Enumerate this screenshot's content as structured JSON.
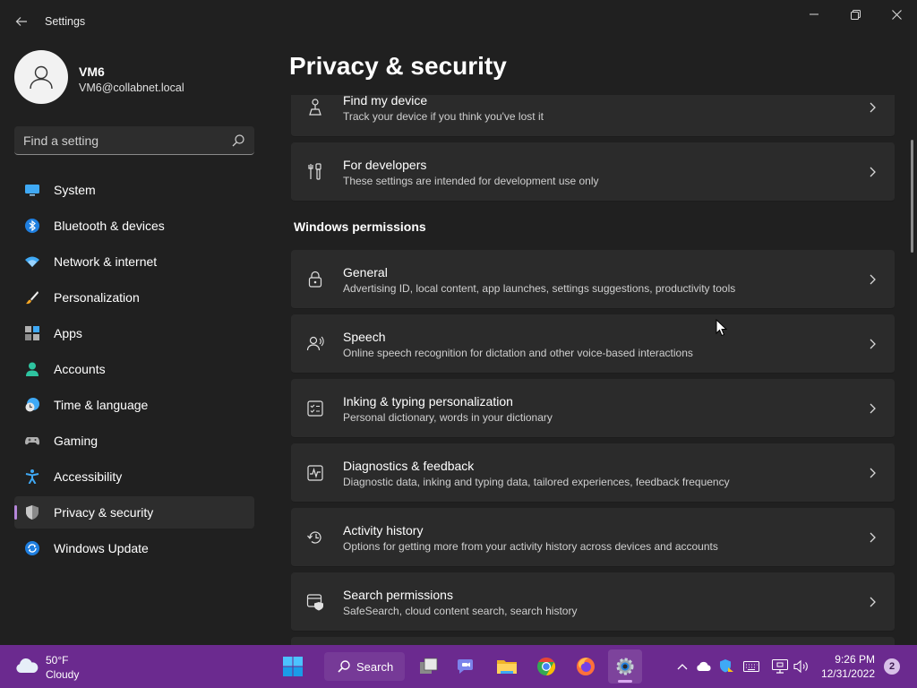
{
  "app": {
    "title": "Settings"
  },
  "profile": {
    "name": "VM6",
    "email": "VM6@collabnet.local"
  },
  "search": {
    "placeholder": "Find a setting"
  },
  "sidebar": {
    "items": [
      {
        "label": "System",
        "icon": "monitor-icon"
      },
      {
        "label": "Bluetooth & devices",
        "icon": "bluetooth-icon"
      },
      {
        "label": "Network & internet",
        "icon": "wifi-icon"
      },
      {
        "label": "Personalization",
        "icon": "brush-icon"
      },
      {
        "label": "Apps",
        "icon": "apps-icon"
      },
      {
        "label": "Accounts",
        "icon": "person-icon"
      },
      {
        "label": "Time & language",
        "icon": "clock-globe-icon"
      },
      {
        "label": "Gaming",
        "icon": "gamepad-icon"
      },
      {
        "label": "Accessibility",
        "icon": "accessibility-icon"
      },
      {
        "label": "Privacy & security",
        "icon": "shield-icon",
        "active": true
      },
      {
        "label": "Windows Update",
        "icon": "update-icon"
      }
    ]
  },
  "page": {
    "title": "Privacy & security",
    "section_windows_permissions": "Windows permissions",
    "cards": [
      {
        "title": "Find my device",
        "desc": "Track your device if you think you've lost it",
        "icon": "person-location-icon"
      },
      {
        "title": "For developers",
        "desc": "These settings are intended for development use only",
        "icon": "developer-tools-icon"
      },
      {
        "title": "General",
        "desc": "Advertising ID, local content, app launches, settings suggestions, productivity tools",
        "icon": "lock-icon"
      },
      {
        "title": "Speech",
        "desc": "Online speech recognition for dictation and other voice-based interactions",
        "icon": "speech-icon"
      },
      {
        "title": "Inking & typing personalization",
        "desc": "Personal dictionary, words in your dictionary",
        "icon": "checklist-icon"
      },
      {
        "title": "Diagnostics & feedback",
        "desc": "Diagnostic data, inking and typing data, tailored experiences, feedback frequency",
        "icon": "pulse-icon"
      },
      {
        "title": "Activity history",
        "desc": "Options for getting more from your activity history across devices and accounts",
        "icon": "history-icon"
      },
      {
        "title": "Search permissions",
        "desc": "SafeSearch, cloud content search, search history",
        "icon": "search-shield-icon"
      }
    ]
  },
  "taskbar": {
    "weather": {
      "temp": "50°F",
      "condition": "Cloudy"
    },
    "search_label": "Search",
    "clock": {
      "time": "9:26 PM",
      "date": "12/31/2022"
    },
    "notification_count": "2"
  },
  "colors": {
    "accent": "#b586d9",
    "taskbar": "#6b2a8f",
    "background": "#202020",
    "card": "#2b2b2b"
  }
}
